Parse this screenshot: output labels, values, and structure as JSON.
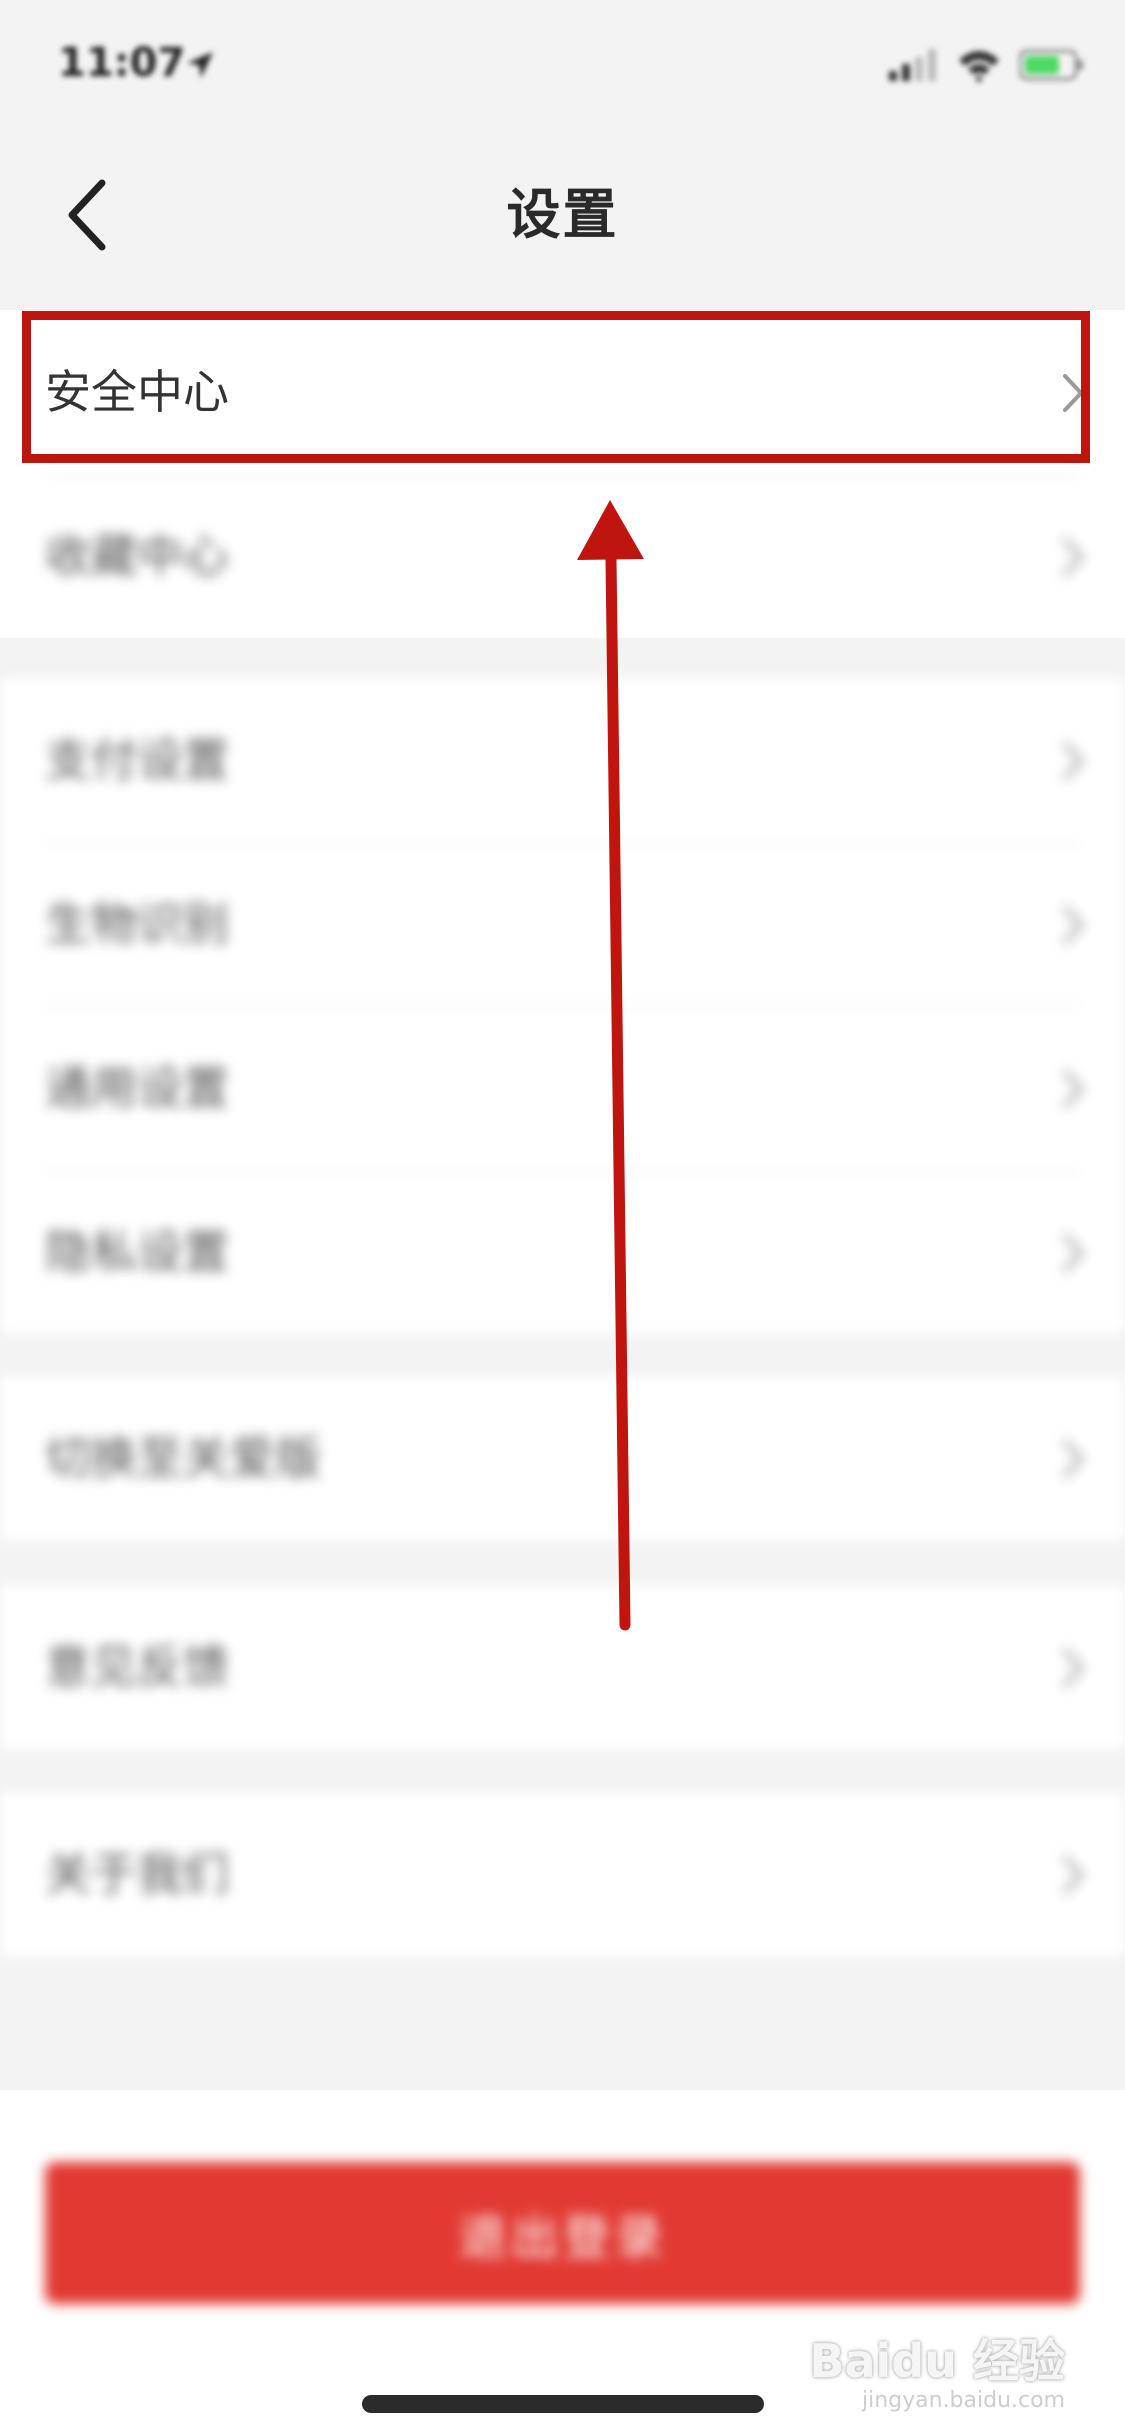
{
  "status_bar": {
    "time": "11:07",
    "icons": [
      "location-arrow-icon",
      "cellular-signal-icon",
      "wifi-icon",
      "battery-icon"
    ]
  },
  "nav": {
    "title": "设置",
    "back_icon": "chevron-left-icon"
  },
  "groups": [
    {
      "items": [
        {
          "label": "安全中心",
          "highlighted": true
        },
        {
          "label": "收藏中心"
        }
      ]
    },
    {
      "items": [
        {
          "label": "支付设置"
        },
        {
          "label": "生物识别"
        },
        {
          "label": "通用设置"
        },
        {
          "label": "隐私设置"
        }
      ]
    },
    {
      "items": [
        {
          "label": "切换至关爱版"
        }
      ]
    },
    {
      "items": [
        {
          "label": "意见反馈"
        }
      ]
    },
    {
      "items": [
        {
          "label": "关于我们"
        }
      ]
    }
  ],
  "logout": {
    "label": "退出登录"
  },
  "watermark": {
    "text": "Baidu 经验",
    "sub": "jingyan.baidu.com"
  },
  "colors": {
    "highlight_border": "#c0140f",
    "arrow": "#c0140f",
    "logout_bg": "#e23a33",
    "page_bg": "#f3f3f3"
  }
}
